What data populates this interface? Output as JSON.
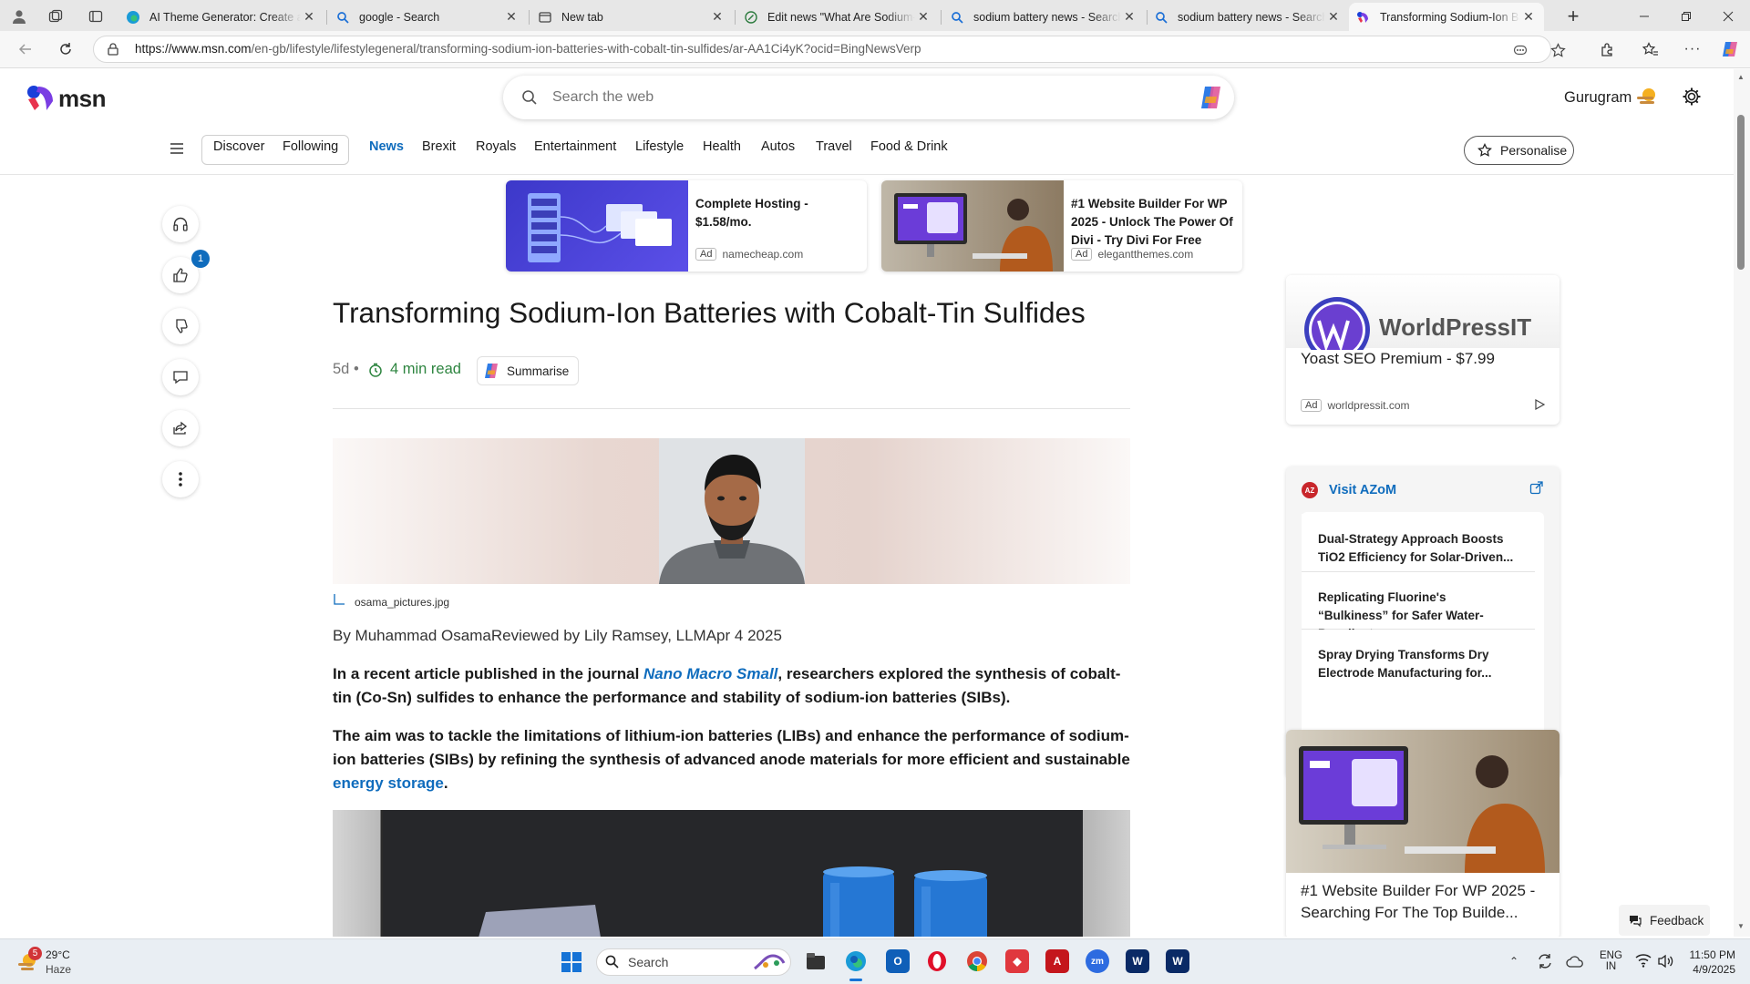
{
  "browser": {
    "tabs": [
      {
        "title": "AI Theme Generator: Create a Ci"
      },
      {
        "title": "google - Search"
      },
      {
        "title": "New tab"
      },
      {
        "title": "Edit news \"What Are Sodium-Io"
      },
      {
        "title": "sodium battery news - Search"
      },
      {
        "title": "sodium battery news - Search"
      },
      {
        "title": "Transforming Sodium-Ion Batte"
      }
    ],
    "url_host": "https://www.msn.com",
    "url_path": "/en-gb/lifestyle/lifestylegeneral/transforming-sodium-ion-batteries-with-cobalt-tin-sulfides/ar-AA1Ci4yK?ocid=BingNewsVerp"
  },
  "header": {
    "logo": "msn",
    "search_placeholder": "Search the web",
    "location": "Gurugram"
  },
  "nav": {
    "discover": "Discover",
    "following": "Following",
    "items": [
      "News",
      "Brexit",
      "Royals",
      "Entertainment",
      "Lifestyle",
      "Health",
      "Autos",
      "Travel",
      "Food & Drink"
    ],
    "personalise": "Personalise"
  },
  "sidebar": {
    "like_count": "1"
  },
  "ads": [
    {
      "text": "Complete Hosting - $1.58/mo.",
      "tag": "Ad",
      "source": "namecheap.com"
    },
    {
      "text": "#1 Website Builder For WP 2025 - Unlock The Power Of Divi - Try Divi For Free",
      "tag": "Ad",
      "source": "elegantthemes.com"
    }
  ],
  "article": {
    "title": "Transforming Sodium-Ion Batteries with Cobalt-Tin Sulfides",
    "age": "5d",
    "read_time": "4 min read",
    "summarise": "Summarise",
    "image_caption": "osama_pictures.jpg",
    "byline": "By Muhammad OsamaReviewed by Lily Ramsey, LLMApr 4 2025",
    "p1_before": "In a recent article published in the journal ",
    "p1_link": "Nano Macro Small",
    "p1_after": ", researchers explored the synthesis of cobalt-tin (Co-Sn) sulfides to enhance the performance and stability of sodium-ion batteries (SIBs).",
    "p2_before": "The aim was to tackle the limitations of lithium-ion batteries (LIBs) and enhance the performance of sodium-ion batteries (SIBs) by refining the synthesis of advanced anode materials for more efficient and sustainable ",
    "p2_link": "energy storage",
    "p2_after": "."
  },
  "right_rail": {
    "ad1": {
      "brand": "WorldPressIT",
      "title": "Yoast SEO Premium - $7.99",
      "tag": "Ad",
      "source": "worldpressit.com"
    },
    "azom": {
      "badge": "AZ",
      "title": "Visit AZoM",
      "items": [
        "Dual-Strategy Approach Boosts TiO2 Efficiency for Solar-Driven...",
        "Replicating Fluorine's “Bulkiness” for Safer Water-Repellent...",
        "Spray Drying Transforms Dry Electrode Manufacturing for..."
      ]
    },
    "ad2": {
      "title": "#1 Website Builder For WP 2025 - Searching For The Top Builde..."
    },
    "feedback": "Feedback"
  },
  "taskbar": {
    "weather_badge": "5",
    "temp": "29°C",
    "condition": "Haze",
    "search": "Search",
    "lang1": "ENG",
    "lang2": "IN",
    "time": "11:50 PM",
    "date": "4/9/2025"
  }
}
